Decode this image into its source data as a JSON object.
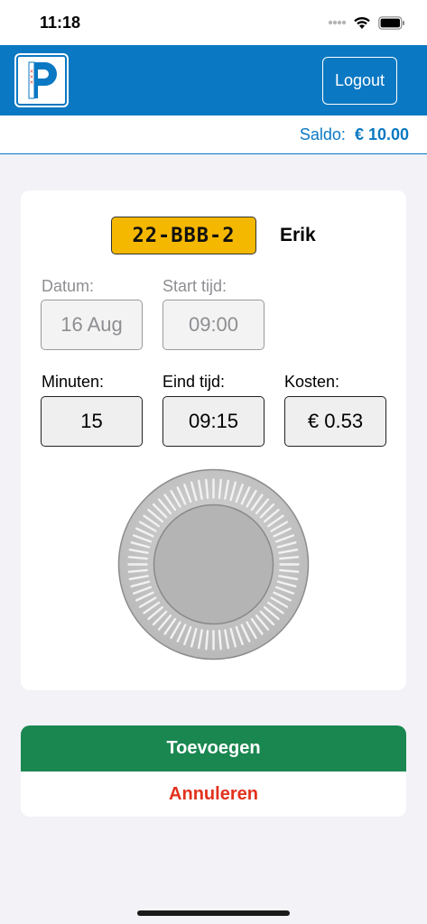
{
  "status_bar": {
    "time": "11:18",
    "icons": [
      "signal-dots-icon",
      "wifi-icon",
      "battery-icon"
    ]
  },
  "header": {
    "logo_icon": "parking-p-amsterdam-icon",
    "logout_label": "Logout",
    "color": "#0a78c2"
  },
  "balance": {
    "label": "Saldo:",
    "value": "€ 10.00"
  },
  "card": {
    "plate": "22-BBB-2",
    "owner": "Erik",
    "date_label": "Datum:",
    "date_value": "16 Aug",
    "start_label": "Start tijd:",
    "start_value": "09:00",
    "minutes_label": "Minuten:",
    "minutes_value": "15",
    "end_label": "Eind tijd:",
    "end_value": "09:15",
    "cost_label": "Kosten:",
    "cost_value": "€ 0.53"
  },
  "actions": {
    "add_label": "Toevoegen",
    "cancel_label": "Annuleren",
    "add_color": "#1a8751",
    "cancel_color": "#e2311d"
  }
}
